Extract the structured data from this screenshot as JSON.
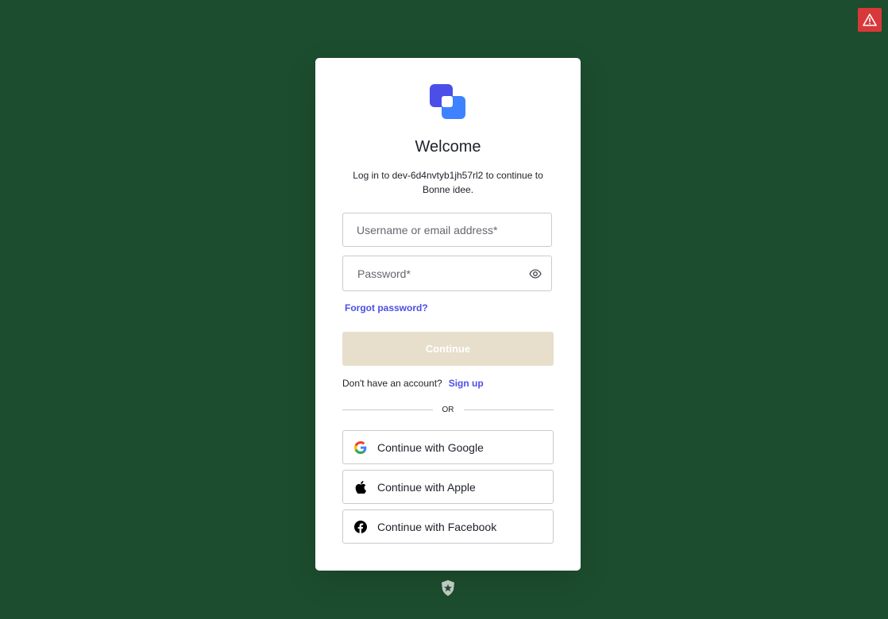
{
  "colors": {
    "background": "#1c4d2e",
    "card": "#ffffff",
    "accent_link": "#4b4fe8",
    "continue_button_bg": "#e7dfcc",
    "logo_primary": "#4b4fe8",
    "logo_secondary": "#3f82ff",
    "warning": "#d9383a"
  },
  "warning_button": {
    "icon": "warning-triangle-icon"
  },
  "login": {
    "logo_icon": "app-logo-icon",
    "title": "Welcome",
    "subtitle": "Log in to dev-6d4nvtyb1jh57rl2 to continue to Bonne idee.",
    "username_placeholder": "Username or email address*",
    "password_placeholder": "Password*",
    "password_toggle_icon": "eye-icon",
    "forgot_password": "Forgot password?",
    "continue_label": "Continue",
    "no_account_text": "Don't have an account?",
    "signup_label": "Sign up",
    "divider_text": "OR",
    "social": [
      {
        "label": "Continue with Google",
        "icon": "google-icon"
      },
      {
        "label": "Continue with Apple",
        "icon": "apple-icon"
      },
      {
        "label": "Continue with Facebook",
        "icon": "facebook-icon"
      }
    ]
  },
  "footer": {
    "icon": "auth-badge-icon"
  }
}
